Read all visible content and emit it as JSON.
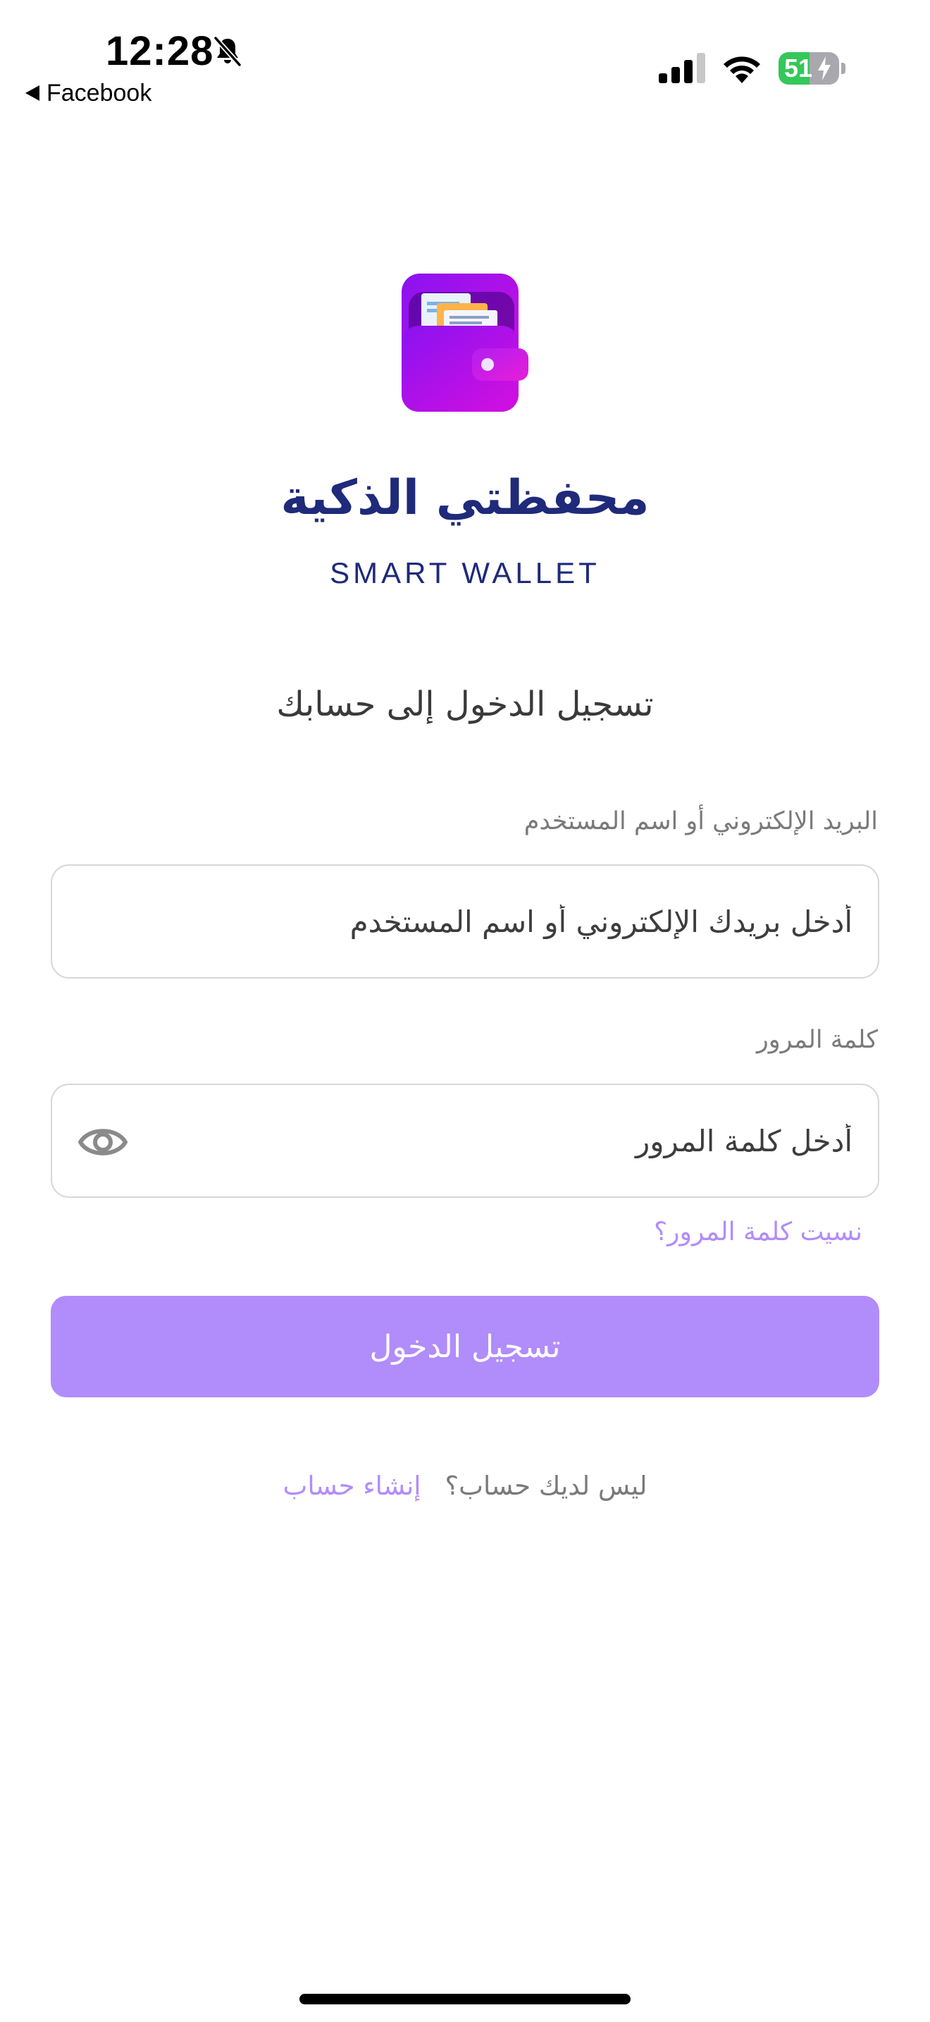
{
  "status_bar": {
    "time": "12:28",
    "back_label": "Facebook",
    "battery_level": "51",
    "battery_fraction": 0.51,
    "battery_color": "#34c759",
    "icons": [
      "bell-slash-icon",
      "cellular-signal-icon",
      "wifi-icon",
      "battery-charging-icon"
    ]
  },
  "app": {
    "title": "محفظتي الذكية",
    "subtitle": "SMART WALLET",
    "logo_icon": "wallet-icon"
  },
  "login": {
    "heading": "تسجيل الدخول إلى حسابك",
    "email_label": "البريد الإلكتروني أو اسم المستخدم",
    "email_placeholder": "أدخل بريدك الإلكتروني أو اسم المستخدم",
    "email_value": "",
    "password_label": "كلمة المرور",
    "password_placeholder": "أدخل كلمة المرور",
    "password_value": "",
    "password_toggle_icon": "eye-icon",
    "forgot_password": "نسيت كلمة المرور؟",
    "submit_label": "تسجيل الدخول",
    "no_account_text": "ليس لديك حساب؟",
    "create_account_link": "إنشاء حساب"
  },
  "colors": {
    "accent": "#b18cfb",
    "title": "#1f2a7a",
    "logo_gradient_start": "#8a12f0",
    "logo_gradient_end": "#d40fe0"
  }
}
